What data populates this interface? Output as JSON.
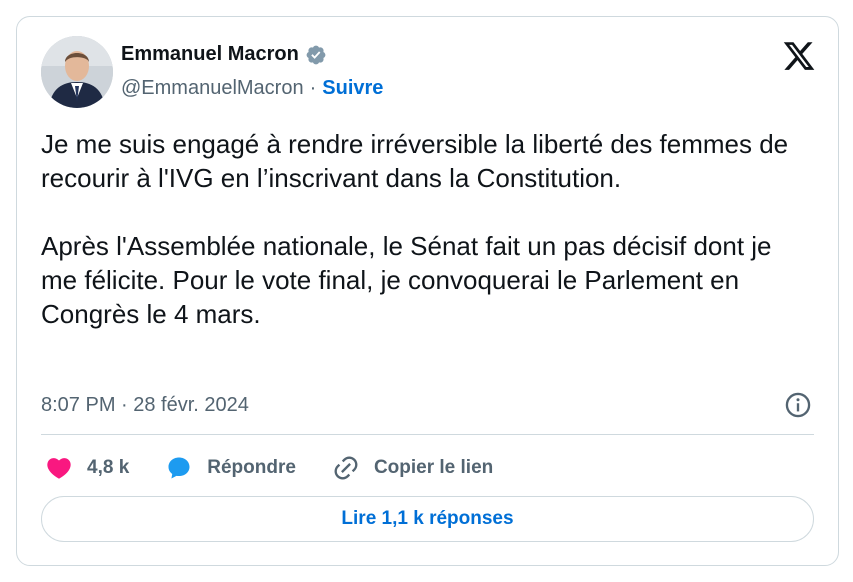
{
  "author": {
    "name": "Emmanuel Macron",
    "handle": "@EmmanuelMacron",
    "separator": "·",
    "follow_label": "Suivre"
  },
  "tweet": {
    "paragraphs": [
      "Je me suis engagé à rendre irréversible la liberté des femmes de recourir à l'IVG en l’inscrivant dans la Constitution.",
      "Après l'Assemblée nationale, le Sénat fait un pas décisif dont je me félicite. Pour le vote final, je convoquerai le Parlement en Congrès le 4 mars."
    ],
    "timestamp": "8:07 PM · 28 févr. 2024"
  },
  "actions": {
    "likes": "4,8 k",
    "reply_label": "Répondre",
    "copy_link_label": "Copier le lien"
  },
  "replies_button_label": "Lire 1,1 k réponses",
  "icons": [
    "verified-badge-icon",
    "x-logo-icon",
    "info-icon",
    "heart-icon",
    "reply-icon",
    "link-icon"
  ],
  "colors": {
    "accent": "#006fd6",
    "like": "#f91880",
    "verified": "#829aab",
    "muted": "#536471"
  }
}
